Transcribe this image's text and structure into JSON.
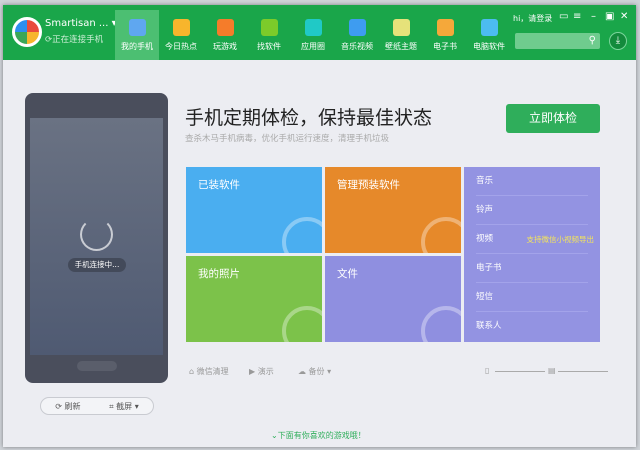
{
  "header": {
    "device_name": "Smartisan ...",
    "status": "正在连接手机",
    "greeting": "hi，请登录",
    "nav": [
      {
        "label": "我的手机",
        "color": "#5fa7f0",
        "active": true
      },
      {
        "label": "今日热点",
        "color": "#f7b52c"
      },
      {
        "label": "玩游戏",
        "color": "#f57c2a"
      },
      {
        "label": "找软件",
        "color": "#7ccb2a"
      },
      {
        "label": "应用圈",
        "color": "#20c9c6"
      },
      {
        "label": "音乐视频",
        "color": "#3e9cf0"
      },
      {
        "label": "壁纸主题",
        "color": "#e6e27a"
      },
      {
        "label": "电子书",
        "color": "#f5a83a"
      },
      {
        "label": "电脑软件",
        "color": "#4cbcf0"
      }
    ]
  },
  "phone": {
    "connecting": "手机连接中...",
    "refresh": "刷新",
    "screenshot": "截屏"
  },
  "main": {
    "title": "手机定期体检，保持最佳状态",
    "subtitle": "查杀木马手机病毒，优化手机运行速度，清理手机垃圾",
    "check_button": "立即体检",
    "tiles": [
      {
        "label": "已装软件",
        "color": "#4aaef0"
      },
      {
        "label": "管理预装软件",
        "color": "#e6892a"
      },
      {
        "label": "我的照片",
        "color": "#7cc24a"
      },
      {
        "label": "文件",
        "color": "#8f8fe0"
      }
    ],
    "list": [
      {
        "label": "音乐"
      },
      {
        "label": "铃声"
      },
      {
        "label": "视频",
        "badge": "支持微信小视频导出"
      },
      {
        "label": "电子书"
      },
      {
        "label": "短信"
      },
      {
        "label": "联系人"
      }
    ],
    "toolbar": {
      "wechat_clean": "微信清理",
      "demo": "演示",
      "backup": "备份"
    },
    "footer": "下面有你喜欢的游戏哦！"
  }
}
